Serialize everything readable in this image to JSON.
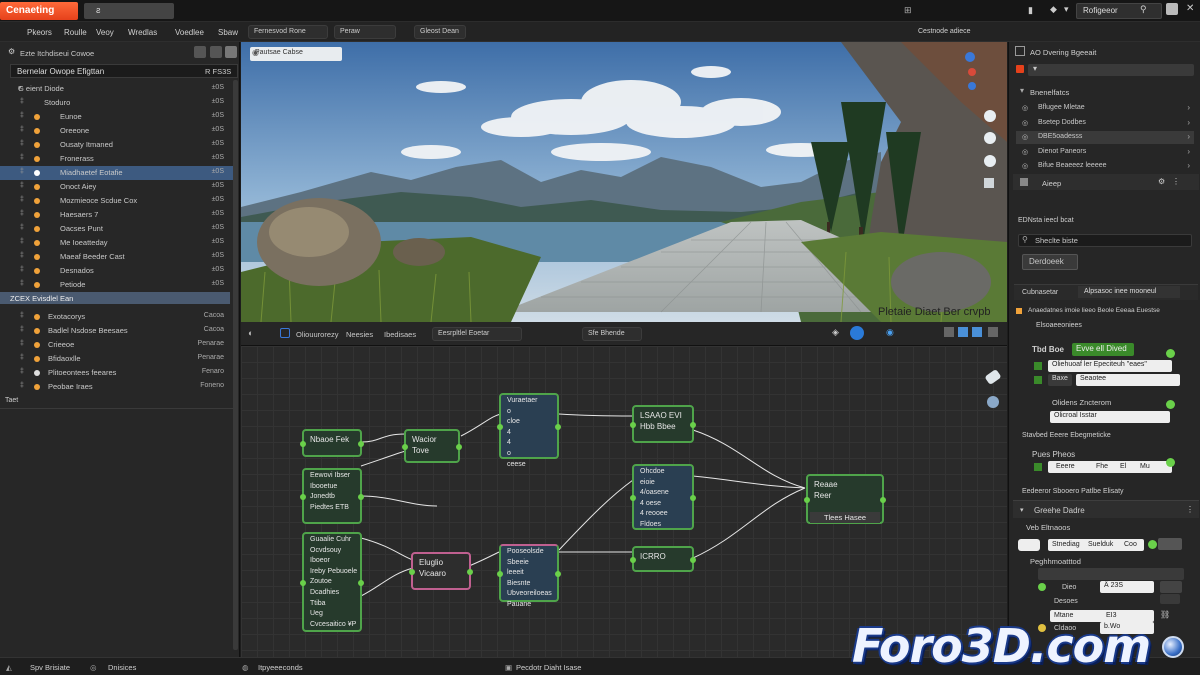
{
  "topbar": {
    "app_title": "Cenaeting",
    "tab2": "ƨ",
    "search_value": "Rofigeeor"
  },
  "menu": [
    "Pkeors",
    "Roulle",
    "Veoy",
    "Wredlas",
    "Voedlee",
    "Sbaw"
  ],
  "toolbar": {
    "mode": "Fernesvod Rone",
    "view": "Peraw",
    "shading": "Gleost Dean",
    "right_label": "Cestnode adiece"
  },
  "outliner": {
    "title": "Ezte Itchdiseui Cowoe",
    "header": "Bernelar Owope Efigttan",
    "header_right": "R FS3S",
    "scene": {
      "label": "G eient Diode",
      "count": "±0S"
    },
    "items": [
      {
        "label": "Stoduro",
        "count": "±0S"
      },
      {
        "label": "Eunoe",
        "count": "±0S"
      },
      {
        "label": "Oreeone",
        "count": "±0S"
      },
      {
        "label": "Ousaty Itmaned",
        "count": "±0S"
      },
      {
        "label": "Fronerass",
        "count": "±0S"
      },
      {
        "label": "Miadhaetef Eotafie",
        "count": "±0S",
        "selected": true
      },
      {
        "label": "Onoct Aiey",
        "count": "±0S"
      },
      {
        "label": "Mozmieoce Scdue Cox",
        "count": "±0S"
      },
      {
        "label": "Haesaers 7",
        "count": "±0S"
      },
      {
        "label": "Oacses Punt",
        "count": "±0S"
      },
      {
        "label": "Me Ioeatteday",
        "count": "±0S"
      },
      {
        "label": "Maeaf Beeder Cast",
        "count": "±0S"
      },
      {
        "label": "Desnados",
        "count": "±0S"
      },
      {
        "label": "Petiode",
        "count": "±0S"
      }
    ],
    "collection": "ZCEX  Evisdlel Ean",
    "items2": [
      {
        "label": "Exotacorys",
        "count": "Cacoa"
      },
      {
        "label": "Badlel Nsdose Beesaes",
        "count": "Cacoa"
      },
      {
        "label": "Crieeoe",
        "count": "Penarae"
      },
      {
        "label": "Bfidaoxlle",
        "count": "Penarae"
      },
      {
        "label": "Plitoeontees feeares",
        "count": "Fenaro"
      },
      {
        "label": "Peobae Iraes",
        "count": "Foneno"
      }
    ],
    "footer": "Taet"
  },
  "viewport": {
    "header": "Pautsae Cabse",
    "caption": "Pletaie Diaet Ber crvpb"
  },
  "node_header": {
    "a": "Oliouurorezy",
    "b": "Neesies",
    "c": "Ibedisaes",
    "d": "Eesrpltlel Eoetar",
    "e": "Sfe Bhende"
  },
  "nodes": {
    "n1": "Nbaoe Fek",
    "n2a": "Wacior",
    "n2b": "Tove",
    "n3": [
      "Vuraetaer",
      "o",
      "cloe",
      "4",
      "4",
      "o",
      "ceese"
    ],
    "n4a": "LSAAO EVI",
    "n4b": "Hbb Bbee",
    "n5": [
      "Eewovi Ibser",
      "Ibooetue",
      "Jonedtb",
      "Piedtes ETB"
    ],
    "n6": [
      "Ohcdoe",
      "eioie",
      "4/oasene",
      "4 oese",
      "4 reooee",
      "Fldoes"
    ],
    "n7a": "Reaae",
    "n7b": "Reer",
    "n7c": "Tlees Hasee",
    "n8": [
      "Guaalie Cuhr",
      "Ocvdsouy",
      "Iboeor",
      "Ireby Pebuoele",
      "Zoutoe",
      "Dcadhies",
      "Ttiba",
      "Ueg",
      "Cvcesaitico ¥P"
    ],
    "n9a": "Eluglio",
    "n9b": "Vicaaro",
    "n10": [
      "Pooseolsde",
      "Sbeeie",
      "leeeit",
      "Biesnte",
      "Ubveoreiloeas",
      "Pauane"
    ],
    "n11": "ICRRO"
  },
  "props": {
    "title": "AO Dvering Bgeeait",
    "section1": "Bnenelfatcs",
    "list": [
      "Bflugee Mletae",
      "Bsetep Dodbes",
      "DBE5oadesss",
      "Dienot Paneors",
      "Bifue Beaeeez leeeee"
    ],
    "amp": "Aieep",
    "path": "EDNsta ieecl bcat",
    "search": "Sheclte biste",
    "btn": "Derdoeek",
    "tabs": [
      "Cubnasetar",
      "Alpsasoc inee mooneul"
    ],
    "desc": "Anaedatnes imoie lieeo Beole Eeeaa Euestse",
    "desc2": "Elsoaeeoniees",
    "tbd": "Tbd Boe",
    "evo": "Evve ell Dived",
    "f1": "Oliehuoaf ler Epeciteuh \"eaes\"",
    "f2a": "Baxe",
    "f2b": "Seaotee",
    "zen": "Olidens Zncterom",
    "zenf": "Olicroal Isstar",
    "mod": "Stavbed Eeere Ebegmeticke",
    "pps": "Pues Pheos",
    "pps_f": "Eeere",
    "pps_a": "Fhe",
    "pps_b": "El",
    "pps_c": "Mu",
    "bottom": "Eedeeror Sbooero Patlbe Elisaty",
    "sub_title": "Greehe Dadre",
    "sub_head": "Veb Eltnaoos",
    "sfields": [
      "Stnediag",
      "Suelduk",
      "Coo"
    ],
    "pn": "Peghhmoatttod",
    "s1": "Dieo",
    "s1v": "Â  23S",
    "s2": "Desoes",
    "s3": "Mtane",
    "s3v": "EI3",
    "s4": "Cldaoo",
    "s4v": "b.Wo"
  },
  "status": {
    "a": "Spv Brisiate",
    "b": "Dnisices",
    "c": "Itpyeeeconds",
    "d": "Pecdotr Diaht Isase"
  },
  "watermark": "Foro3D.com",
  "colors": {
    "accent": "#e6411b",
    "node_border": "#4fa44a",
    "socket": "#6ad04a",
    "selection": "#3d5a80"
  }
}
